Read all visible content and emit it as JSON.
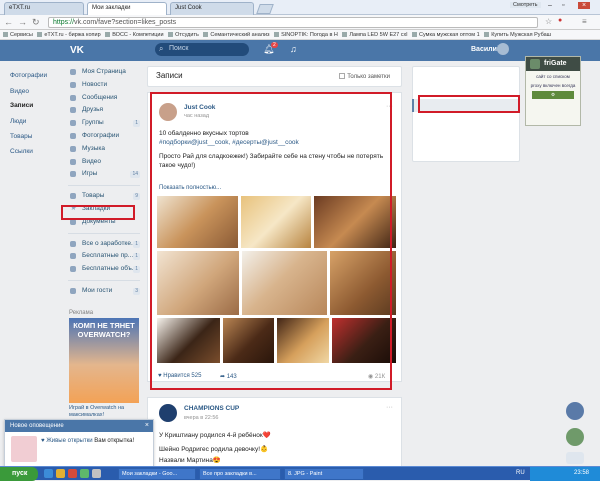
{
  "browser": {
    "tabs": [
      {
        "label": "eTXT.ru"
      },
      {
        "label": "Мои закладки"
      },
      {
        "label": "Just Cook"
      }
    ],
    "active_tab": 1,
    "window_user": "Смотреть",
    "url_scheme": "https://",
    "url_rest": "vk.com/fave?section=likes_posts",
    "bookmarks": [
      "Сервисы",
      "eTXT.ru - биржа копир",
      "ВОСС - Компетиции ",
      "Отсудить",
      "Семантический анализ",
      "SINOPTIK: Погода в Н",
      "Лампа LED 5W E27 cxl",
      "Сумка мужская оптом 1",
      "Купить Мужская Рубаш"
    ]
  },
  "vk": {
    "logo": "VK",
    "search_placeholder": "Поиск",
    "notifications_badge": "2",
    "user_name": "Василий",
    "sidebar": [
      {
        "label": "Моя Страница",
        "count": ""
      },
      {
        "label": "Новости",
        "count": ""
      },
      {
        "label": "Сообщения",
        "count": ""
      },
      {
        "label": "Друзья",
        "count": ""
      },
      {
        "label": "Группы",
        "count": "1"
      },
      {
        "label": "Фотографии",
        "count": ""
      },
      {
        "label": "Музыка",
        "count": ""
      },
      {
        "label": "Видео",
        "count": ""
      },
      {
        "label": "Игры",
        "count": "14"
      }
    ],
    "sidebar2": [
      {
        "label": "Товары",
        "count": "9"
      },
      {
        "label": "Закладки",
        "count": ""
      },
      {
        "label": "Документы",
        "count": ""
      }
    ],
    "sidebar3": [
      {
        "label": "Все о заработке...",
        "count": "1"
      },
      {
        "label": "Бесплатные пр...",
        "count": "1"
      },
      {
        "label": "Бесплатные объ...",
        "count": "1"
      }
    ],
    "sidebar4": [
      {
        "label": "Мои гости",
        "count": "3"
      }
    ],
    "ad": {
      "title": "Реклама",
      "image_text": "КОМП НЕ ТЯНЕТ OVERWATCH?",
      "text": "Играй в Overwatch на максималках!"
    },
    "feed": {
      "title": "Записи",
      "only_notes": "Только заметки"
    },
    "post": {
      "author": "Just Cook",
      "time": "час назад",
      "line1": "10 обалденно вкусных тортов",
      "tags": "#подборки@just__cook, #десерты@just__cook",
      "line2": "Просто Рай для сладкоежек!) Забирайте себе на стену чтобы не потерять такое чудо!)",
      "show_more": "Показать полностью...",
      "likes_label": "Нравится",
      "likes": "525",
      "shares": "143",
      "views": "21К"
    },
    "post2": {
      "author": "CHAMPIONS CUP",
      "time": "вчера в 22:56",
      "lines": [
        "У Криштиану родился 4-й ребёнок❤️",
        "Шейно Родригес родила девочку!👶",
        "Назвали Мартина😍"
      ]
    },
    "right_menu": [
      "Фотографии",
      "Видео",
      "Записи",
      "Люди",
      "Товары",
      "Ссылки"
    ],
    "right_active": 2,
    "notification": {
      "title": "Новое оповещение",
      "close": "×",
      "text_link": "♥ Живые открытки",
      "text_rest": "Вам открытка!"
    }
  },
  "extension": {
    "name": "friGate",
    "sub1": "сайт со списком",
    "sub2": "proxy включен всегда",
    "button": "⚙"
  },
  "taskbar": {
    "start": "пуск",
    "items": [
      "Мои закладки - Goo...",
      "Все про закладки в...",
      "8. JPG - Paint"
    ],
    "lang": "RU",
    "clock": "23:58"
  },
  "colors": {
    "vk_blue": "#4a76a8",
    "highlight": "#d11b28"
  }
}
